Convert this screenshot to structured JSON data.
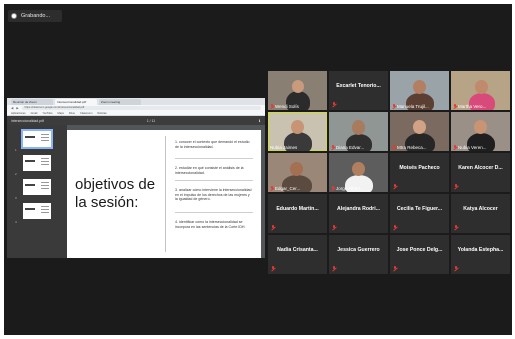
{
  "recording": {
    "label": "Grabando..."
  },
  "browser": {
    "tabs": [
      "Reunión de Zoom",
      "Interseccionalidad.pdf",
      "Zoom meeting"
    ],
    "address": "https://classroom.google.com/interseccionalidad.pdf",
    "bookmarks": [
      "Aplicaciones",
      "Gmail",
      "YouTube",
      "Maps",
      "Drive",
      "Classroom",
      "Noticias"
    ]
  },
  "pdf": {
    "filename": "interseccionalidad.pdf",
    "page_indicator": "1 / 11",
    "thumbnails": [
      "1",
      "2",
      "3",
      "4"
    ],
    "slide_title": "objetivos de la sesión:",
    "objectives": [
      "1. conocer el contexto que demandó el estudio de la interseccionalidad.",
      "2. estudiar en qué consiste el análisis de la interseccionalidad.",
      "3. analizar cómo interviene la interseccionalidad en el impulso de los derechos de las mujeres y la igualdad de género.",
      "4. identificar cómo la interseccionalidad se incorpora en las sentencias de la Corte IDH."
    ]
  },
  "participants": [
    {
      "name": "Wendi Solís",
      "video": true,
      "muted": true
    },
    {
      "name": "Excarlet Tenorio...",
      "video": false,
      "muted": true
    },
    {
      "name": "Manuela Trujil...",
      "video": true,
      "muted": true
    },
    {
      "name": "Martha Vero...",
      "video": true,
      "muted": true
    },
    {
      "name": "Nubia Jaimes",
      "video": true,
      "muted": false,
      "speaking": true
    },
    {
      "name": "Diana Edvar...",
      "video": true,
      "muted": true
    },
    {
      "name": "Mtra Rebeca...",
      "video": true,
      "muted": true
    },
    {
      "name": "Nubia Veren...",
      "video": true,
      "muted": true
    },
    {
      "name": "Edgar_Cer...",
      "video": true,
      "muted": true
    },
    {
      "name": "Jorge Albert...",
      "video": true,
      "muted": true
    },
    {
      "name": "Moisés Pacheco",
      "video": false,
      "muted": true
    },
    {
      "name": "Karen Alcocer D...",
      "video": false,
      "muted": true
    },
    {
      "name": "Eduardo Martín...",
      "video": false,
      "muted": true
    },
    {
      "name": "Alejandra Rodri...",
      "video": false,
      "muted": true
    },
    {
      "name": "Cecilia Te Figuer...",
      "video": false,
      "muted": true
    },
    {
      "name": "Katya Alcocer",
      "video": false,
      "muted": true
    },
    {
      "name": "Nadia Crisanta...",
      "video": false,
      "muted": true
    },
    {
      "name": "Jessica Guerrero",
      "video": false,
      "muted": true
    },
    {
      "name": "Jose Ponce Delg...",
      "video": false,
      "muted": true
    },
    {
      "name": "Yolanda Estepha...",
      "video": false,
      "muted": true
    }
  ],
  "colors": {
    "muted": "#e53935",
    "speaking": "#cddc39",
    "tile_bg": "#2e2e2e",
    "app_bg": "#1b1b1b"
  }
}
